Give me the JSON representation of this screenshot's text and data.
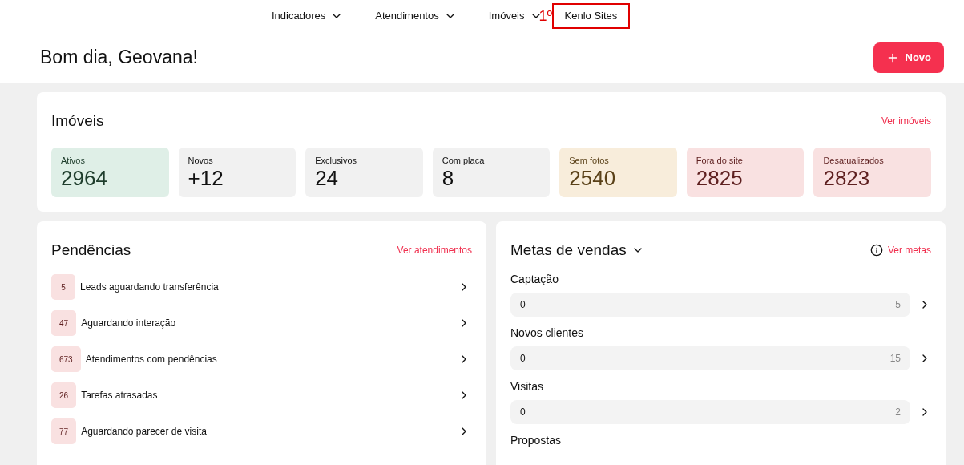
{
  "nav": [
    {
      "label": "Indicadores",
      "dropdown": true,
      "highlighted": false
    },
    {
      "label": "Atendimentos",
      "dropdown": true,
      "highlighted": false
    },
    {
      "label": "Imóveis",
      "dropdown": true,
      "highlighted": false,
      "annotation": "1º"
    },
    {
      "label": "Kenlo Sites",
      "dropdown": false,
      "highlighted": true
    }
  ],
  "greeting": "Bom dia, Geovana!",
  "new_button": "Novo",
  "imoveis": {
    "title": "Imóveis",
    "link": "Ver imóveis",
    "stats": [
      {
        "label": "Ativos",
        "value": "2964",
        "kind": "success"
      },
      {
        "label": "Novos",
        "value": "+12",
        "kind": "neutral"
      },
      {
        "label": "Exclusivos",
        "value": "24",
        "kind": "neutral"
      },
      {
        "label": "Com placa",
        "value": "8",
        "kind": "neutral"
      },
      {
        "label": "Sem fotos",
        "value": "2540",
        "kind": "warning"
      },
      {
        "label": "Fora do site",
        "value": "2825",
        "kind": "danger"
      },
      {
        "label": "Desatualizados",
        "value": "2823",
        "kind": "danger"
      }
    ]
  },
  "pendencias": {
    "title": "Pendências",
    "link": "Ver atendimentos",
    "items": [
      {
        "count": "5",
        "label": "Leads aguardando transferência"
      },
      {
        "count": "47",
        "label": "Aguardando interação"
      },
      {
        "count": "673",
        "label": "Atendimentos com pendências"
      },
      {
        "count": "26",
        "label": "Tarefas atrasadas"
      },
      {
        "count": "77",
        "label": "Aguardando parecer de visita"
      }
    ]
  },
  "metas": {
    "title": "Metas de vendas",
    "link": "Ver metas",
    "goals": [
      {
        "label": "Captação",
        "current": "0",
        "target": "5",
        "level": 0
      },
      {
        "label": "Novos clientes",
        "current": "0",
        "target": "15",
        "level": 0
      },
      {
        "label": "Visitas",
        "current": "0",
        "target": "2",
        "level": 0
      },
      {
        "label": "Propostas"
      }
    ]
  }
}
